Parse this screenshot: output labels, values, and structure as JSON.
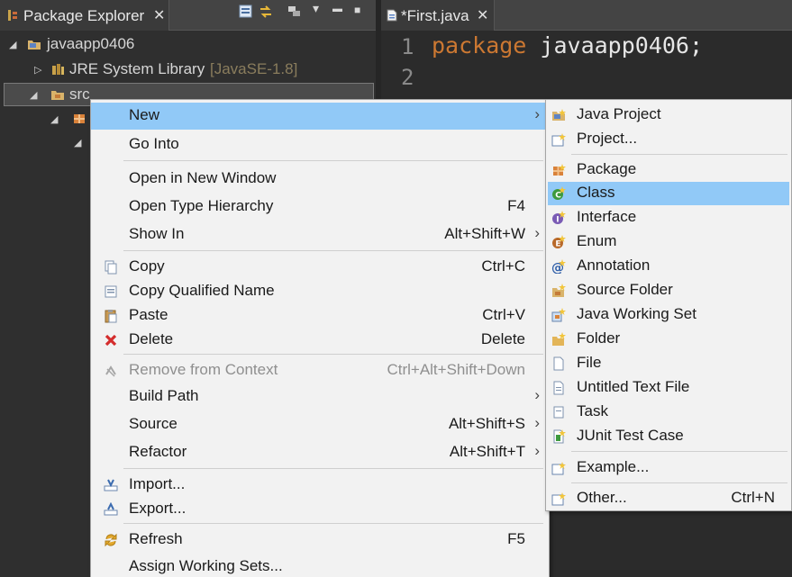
{
  "package_explorer": {
    "tab_title": "Package Explorer",
    "close_glyph": "✕",
    "toolbar_menu_glyph": "▾",
    "toolbar_min_glyph": "▬",
    "toolbar_max_glyph": "■",
    "tree": {
      "project": "javaapp0406",
      "jre_label": "JRE System Library",
      "jre_version": "[JavaSE-1.8]",
      "src": "src"
    }
  },
  "editor": {
    "tab_title": "*First.java",
    "close_glyph": "✕",
    "line1_no": "1",
    "line2_no": "2",
    "line1_kw": "package",
    "line1_rest": " javaapp0406;"
  },
  "context_menu": {
    "items": [
      {
        "label": "New",
        "shortcut": "",
        "submenu": "›"
      },
      {
        "label": "Go Into",
        "shortcut": ""
      },
      {
        "label": "Open in New Window",
        "shortcut": ""
      },
      {
        "label": "Open Type Hierarchy",
        "shortcut": "F4"
      },
      {
        "label": "Show In",
        "shortcut": "Alt+Shift+W",
        "submenu": "›"
      },
      {
        "label": "Copy",
        "shortcut": "Ctrl+C"
      },
      {
        "label": "Copy Qualified Name",
        "shortcut": ""
      },
      {
        "label": "Paste",
        "shortcut": "Ctrl+V"
      },
      {
        "label": "Delete",
        "shortcut": "Delete"
      },
      {
        "label": "Remove from Context",
        "shortcut": "Ctrl+Alt+Shift+Down"
      },
      {
        "label": "Build Path",
        "shortcut": "",
        "submenu": "›"
      },
      {
        "label": "Source",
        "shortcut": "Alt+Shift+S",
        "submenu": "›"
      },
      {
        "label": "Refactor",
        "shortcut": "Alt+Shift+T",
        "submenu": "›"
      },
      {
        "label": "Import...",
        "shortcut": ""
      },
      {
        "label": "Export...",
        "shortcut": ""
      },
      {
        "label": "Refresh",
        "shortcut": "F5"
      },
      {
        "label": "Assign Working Sets...",
        "shortcut": ""
      }
    ]
  },
  "new_submenu": {
    "items": [
      {
        "label": "Java Project"
      },
      {
        "label": "Project..."
      },
      {
        "label": "Package"
      },
      {
        "label": "Class"
      },
      {
        "label": "Interface"
      },
      {
        "label": "Enum"
      },
      {
        "label": "Annotation"
      },
      {
        "label": "Source Folder"
      },
      {
        "label": "Java Working Set"
      },
      {
        "label": "Folder"
      },
      {
        "label": "File"
      },
      {
        "label": "Untitled Text File"
      },
      {
        "label": "Task"
      },
      {
        "label": "JUnit Test Case"
      },
      {
        "label": "Example..."
      },
      {
        "label": "Other...",
        "shortcut": "Ctrl+N"
      }
    ]
  },
  "colors": {
    "highlight": "#91c9f7",
    "keyword": "#cc7832",
    "menu_bg": "#f2f2f2",
    "dark_bg": "#2f2f2f"
  }
}
